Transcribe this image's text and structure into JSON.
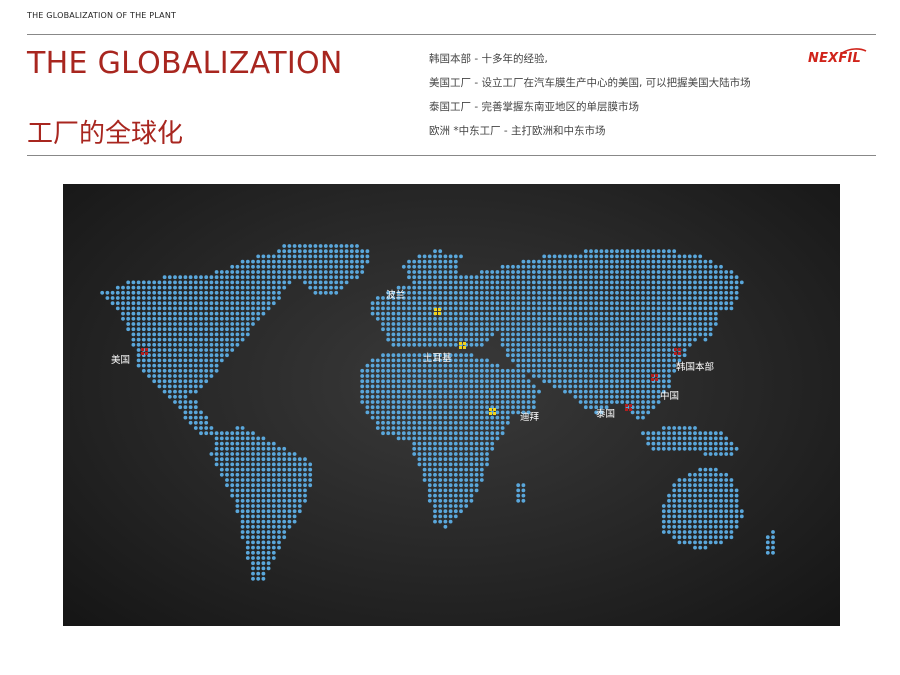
{
  "header": {
    "breadcrumb": "THE GLOBALIZATION OF THE PLANT",
    "title_en": "THE GLOBALIZATION",
    "title_cn": "工厂的全球化",
    "logo_text": "NEXFIL"
  },
  "points": [
    "韩国本部  -  十多年的经验,",
    "美国工厂  -  设立工厂在汽车膜生产中心的美国,  可以把握美国大陆市场",
    "泰国工厂  -   完善掌握东南亚地区的单层膜市场",
    "欧洲 *中东工厂  -   主打欧洲和中东市场"
  ],
  "map": {
    "labels": {
      "poland": "波兰",
      "usa": "美国",
      "turkey": "土耳基",
      "korea_hq": "韩国本部",
      "china": "中国",
      "thailand": "泰国",
      "dubai": "迪拜"
    }
  },
  "colors": {
    "accent": "#a8261f",
    "logo": "#d0231a",
    "dot": "#5aa7db",
    "marker_red": "#b01e1e",
    "marker_yellow": "#f2d21a"
  }
}
